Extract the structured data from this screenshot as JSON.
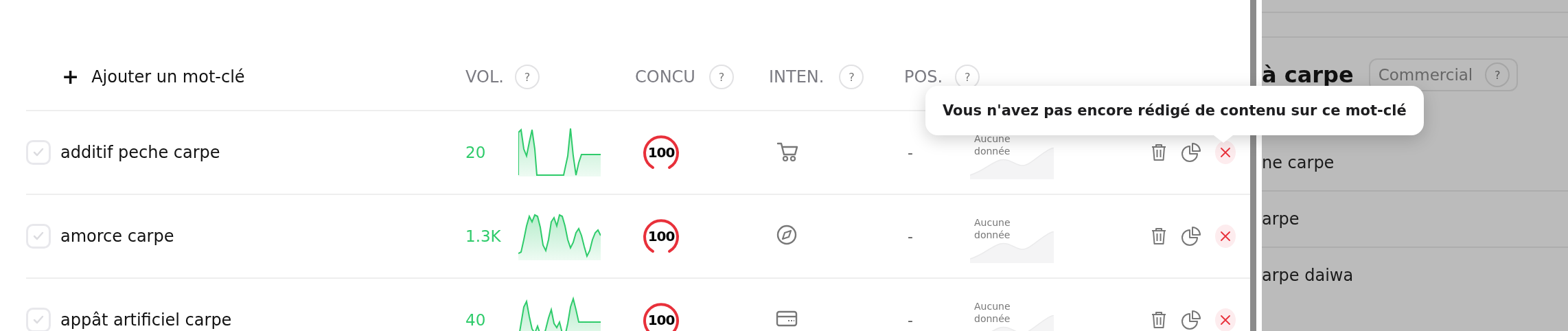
{
  "header": {
    "add_keyword": {
      "icon": "+",
      "label": "Ajouter un mot-clé"
    },
    "columns": [
      {
        "label": "VOL.",
        "help": "?"
      },
      {
        "label": "CONCU",
        "help": "?"
      },
      {
        "label": "INTEN.",
        "help": "?"
      },
      {
        "label": "POS.",
        "help": "?"
      }
    ]
  },
  "rows": [
    {
      "checked": false,
      "keyword": "additif peche carpe",
      "volume": "20",
      "competition": "100",
      "intent": {
        "kind": "transactional"
      },
      "position": "-",
      "position_trend": "Aucune donnée"
    },
    {
      "checked": false,
      "keyword": "amorce carpe",
      "volume": "1.3K",
      "competition": "100",
      "intent": {
        "kind": "navigational"
      },
      "position": "-",
      "position_trend": "Aucune donnée"
    },
    {
      "checked": false,
      "keyword": "appât artificiel carpe",
      "volume": "40",
      "competition": "100",
      "intent": {
        "kind": "commercial"
      },
      "position": "-",
      "position_trend": "Aucune donnée"
    }
  ],
  "tooltip": "Vous n'avez pas encore rédigé de contenu sur ce mot-clé",
  "side_panel": {
    "title": "à carpe",
    "tag": {
      "label": "Commercial",
      "help": "?"
    },
    "items": [
      "ne carpe",
      "arpe",
      "arpe daiwa"
    ]
  }
}
